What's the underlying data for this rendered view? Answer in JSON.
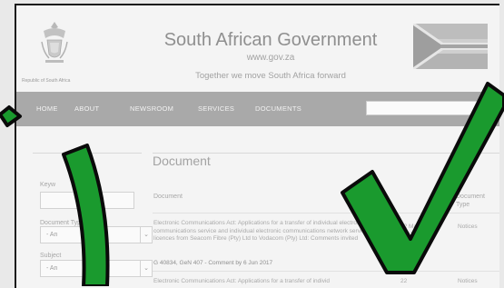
{
  "header": {
    "coat_caption": "Republic of South Africa",
    "title": "South African Government",
    "url": "www.gov.za",
    "tagline": "Together we move South Africa forward"
  },
  "nav": {
    "items": [
      "HOME",
      "ABOUT",
      "NEWSROOM",
      "SERVICES",
      "DOCUMENTS"
    ],
    "search_placeholder": ""
  },
  "sidebar": {
    "keyword_label": "Keyw",
    "doc_type_label": "Document Type",
    "doc_type_value": "- An",
    "subject_label": "Subject",
    "subject_value": "- An"
  },
  "main": {
    "title": "Document",
    "columns": [
      "Document",
      "Document Type"
    ],
    "rows": [
      {
        "text": "Electronic Communications Act: Applications for a transfer of individual electronic communications service and individual electronic communications network service licences from Seacom Fibre (Pty) Ltd to Vodacom (Pty) Ltd: Comments invited",
        "ref": "G 40834, GeN 407 - Comment by 6 Jun 2017",
        "date": "22 May 2017",
        "type": "Notices"
      },
      {
        "text": "Electronic Communications Act: Applications for a transfer of individ",
        "ref": "",
        "date": "22",
        "type": "Notices"
      }
    ]
  },
  "overlay": {
    "check_color": "#1a9a2e",
    "outline_color": "#0a0a0a"
  }
}
